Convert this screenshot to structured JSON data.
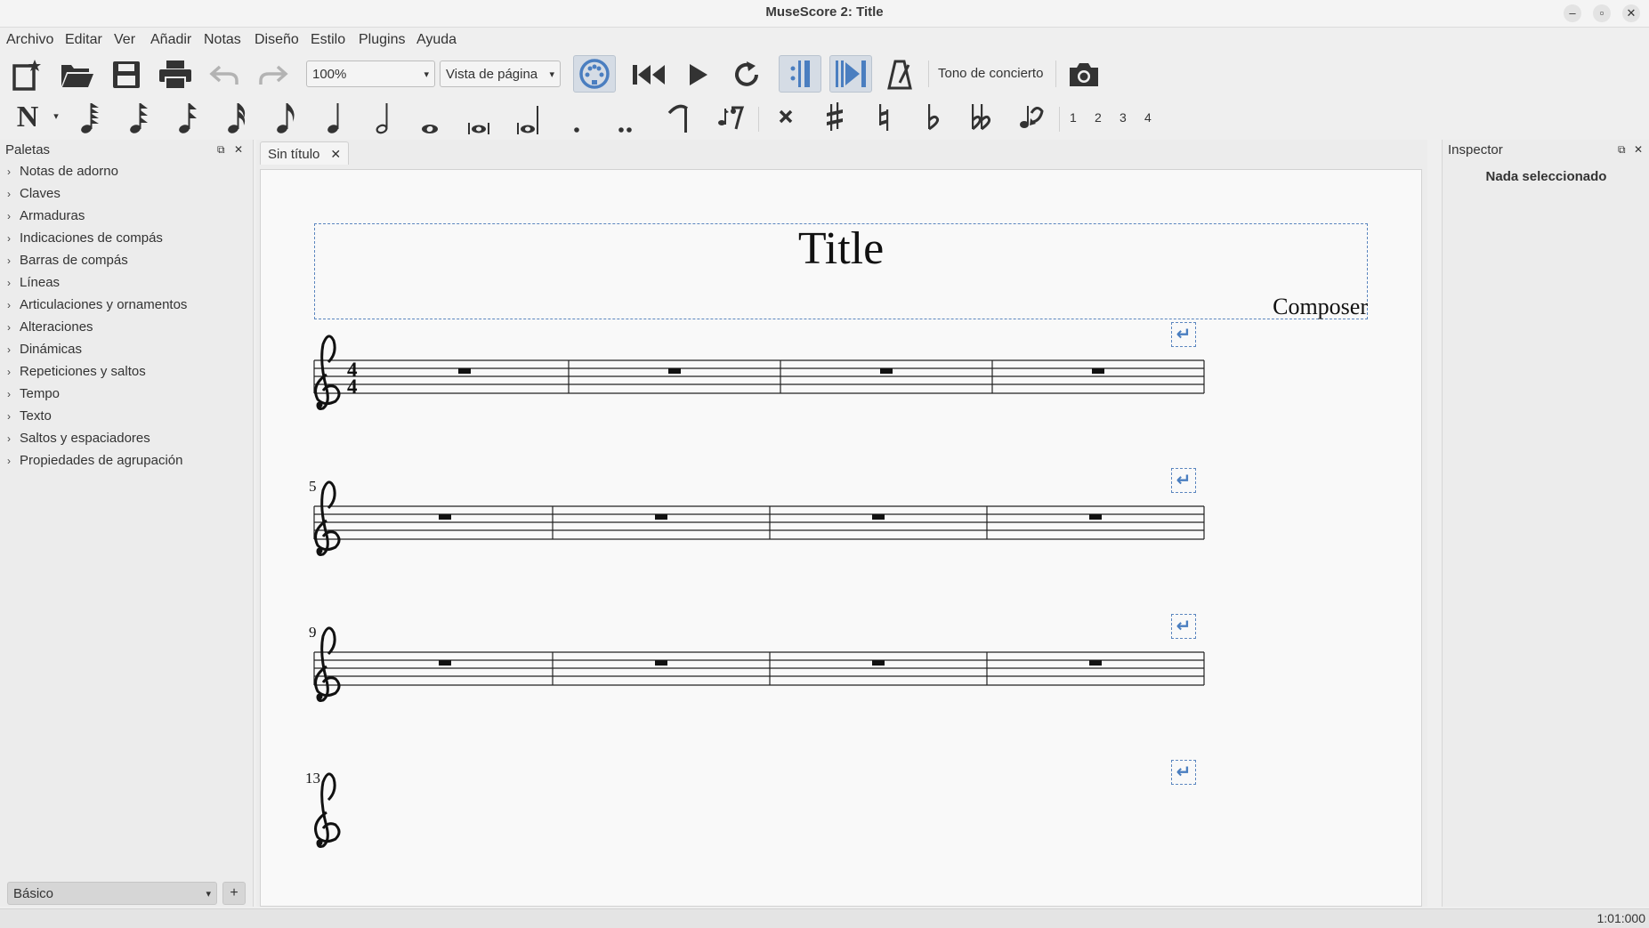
{
  "window": {
    "title": "MuseScore 2: Title"
  },
  "menu": [
    "Archivo",
    "Editar",
    "Ver",
    "Añadir",
    "Notas",
    "Diseño",
    "Estilo",
    "Plugins",
    "Ayuda"
  ],
  "toolbar": {
    "zoom": "100%",
    "view_mode": "Vista de página",
    "concert_pitch": "Tono de concierto",
    "voices": [
      "1",
      "2",
      "3",
      "4"
    ]
  },
  "palettes": {
    "title": "Paletas",
    "items": [
      "Notas de adorno",
      "Claves",
      "Armaduras",
      "Indicaciones de compás",
      "Barras de compás",
      "Líneas",
      "Articulaciones y ornamentos",
      "Alteraciones",
      "Dinámicas",
      "Repeticiones y saltos",
      "Tempo",
      "Texto",
      "Saltos y espaciadores",
      "Propiedades de agrupación"
    ],
    "workspace": "Básico",
    "add": "+"
  },
  "score": {
    "tab": "Sin título",
    "title": "Title",
    "composer": "Composer",
    "time_sig": {
      "top": "4",
      "bottom": "4"
    },
    "systems": [
      {
        "measure_number": ""
      },
      {
        "measure_number": "5"
      },
      {
        "measure_number": "9"
      },
      {
        "measure_number": "13"
      }
    ]
  },
  "inspector": {
    "title": "Inspector",
    "empty": "Nada seleccionado"
  },
  "status": {
    "position": "1:01:000"
  },
  "colors": {
    "accent": "#4a7ec0",
    "frame": "#5b86bf"
  }
}
